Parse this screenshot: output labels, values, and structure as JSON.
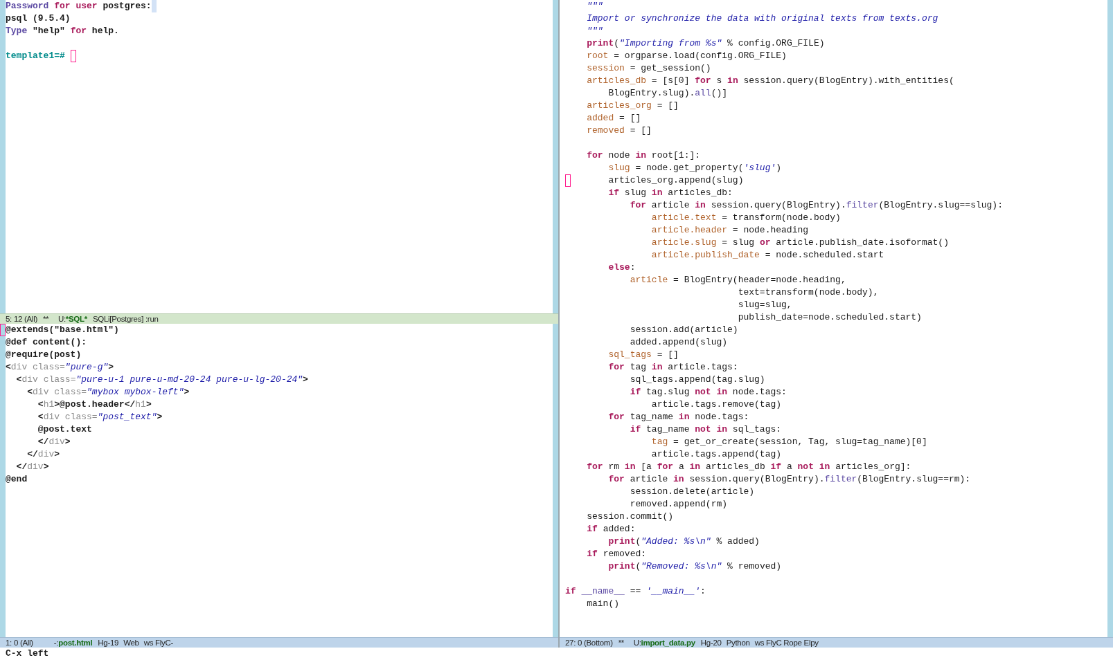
{
  "columns": [
    {
      "windows": [
        {
          "kind": "terminal",
          "selected": true,
          "lines": [
            {
              "kind": "code",
              "tokens": [
                {
                  "kind": "builtin",
                  "text": "Password"
                },
                {
                  "kind": "keyword",
                  "text": " for user"
                },
                {
                  "kind": "plain",
                  "text": " postgres:"
                },
                {
                  "kind": "highlight"
                }
              ]
            },
            {
              "kind": "code",
              "tokens": [
                {
                  "kind": "plain",
                  "text": "psql (9.5.4)"
                }
              ]
            },
            {
              "kind": "code",
              "tokens": [
                {
                  "kind": "builtin",
                  "text": "Type"
                },
                {
                  "kind": "plain",
                  "text": " \"help\" "
                },
                {
                  "kind": "keyword",
                  "text": "for"
                },
                {
                  "kind": "plain",
                  "text": " help."
                }
              ]
            },
            {
              "kind": "blank"
            },
            {
              "kind": "code",
              "tokens": [
                {
                  "kind": "prompt",
                  "text": "template1=#"
                },
                {
                  "kind": "cursor"
                }
              ]
            }
          ],
          "mode_line": {
            "position": "5: 12 (All)",
            "flags": "**",
            "prefix": "U:",
            "buffer": "*SQL*",
            "modes": [
              "SQLi[Postgres] :run"
            ]
          }
        },
        {
          "kind": "template",
          "selected": false,
          "lines": [
            {
              "kind": "code",
              "tokens": [
                {
                  "kind": "cursor"
                },
                {
                  "kind": "plain",
                  "text": "@extends(\"base.html\")"
                }
              ]
            },
            {
              "kind": "code",
              "tokens": [
                {
                  "kind": "plain",
                  "text": "@def content():"
                }
              ]
            },
            {
              "kind": "code",
              "tokens": [
                {
                  "kind": "plain",
                  "text": "@require(post)"
                }
              ]
            },
            {
              "kind": "code",
              "tokens": [
                {
                  "kind": "plain",
                  "text": "<"
                },
                {
                  "kind": "tag",
                  "text": "div class="
                },
                {
                  "kind": "string",
                  "text": "\"pure-g\""
                },
                {
                  "kind": "plain",
                  "text": ">"
                }
              ]
            },
            {
              "kind": "code",
              "tokens": [
                {
                  "kind": "plain",
                  "text": "  <"
                },
                {
                  "kind": "tag",
                  "text": "div class="
                },
                {
                  "kind": "string",
                  "text": "\"pure-u-1 pure-u-md-20-24 pure-u-lg-20-24\""
                },
                {
                  "kind": "plain",
                  "text": ">"
                }
              ]
            },
            {
              "kind": "code",
              "tokens": [
                {
                  "kind": "plain",
                  "text": "    <"
                },
                {
                  "kind": "tag",
                  "text": "div class="
                },
                {
                  "kind": "string",
                  "text": "\"mybox mybox-left\""
                },
                {
                  "kind": "plain",
                  "text": ">"
                }
              ]
            },
            {
              "kind": "code",
              "tokens": [
                {
                  "kind": "plain",
                  "text": "      <"
                },
                {
                  "kind": "tag",
                  "text": "h1"
                },
                {
                  "kind": "plain",
                  "text": ">@post.header</"
                },
                {
                  "kind": "tag",
                  "text": "h1"
                },
                {
                  "kind": "plain",
                  "text": ">"
                }
              ]
            },
            {
              "kind": "code",
              "tokens": [
                {
                  "kind": "plain",
                  "text": "      <"
                },
                {
                  "kind": "tag",
                  "text": "div class="
                },
                {
                  "kind": "string",
                  "text": "\"post_text\""
                },
                {
                  "kind": "plain",
                  "text": ">"
                }
              ]
            },
            {
              "kind": "code",
              "tokens": [
                {
                  "kind": "plain",
                  "text": "      @post.text"
                }
              ]
            },
            {
              "kind": "code",
              "tokens": [
                {
                  "kind": "plain",
                  "text": "      </"
                },
                {
                  "kind": "tag",
                  "text": "div"
                },
                {
                  "kind": "plain",
                  "text": ">"
                }
              ]
            },
            {
              "kind": "code",
              "tokens": [
                {
                  "kind": "plain",
                  "text": "    </"
                },
                {
                  "kind": "tag",
                  "text": "div"
                },
                {
                  "kind": "plain",
                  "text": ">"
                }
              ]
            },
            {
              "kind": "code",
              "tokens": [
                {
                  "kind": "plain",
                  "text": "  </"
                },
                {
                  "kind": "tag",
                  "text": "div"
                },
                {
                  "kind": "plain",
                  "text": ">"
                }
              ]
            },
            {
              "kind": "code",
              "tokens": [
                {
                  "kind": "plain",
                  "text": "@end"
                }
              ]
            }
          ],
          "mode_line": {
            "position": "1: 0 (All)",
            "prefix": "-:",
            "buffer": "post.html",
            "modes": [
              "Hg-19",
              "Web",
              "ws FlyC-"
            ]
          }
        }
      ]
    },
    {
      "windows": [
        {
          "kind": "python",
          "selected": false,
          "lines": [
            {
              "kind": "code",
              "tokens": [
                {
                  "kind": "string",
                  "text": "    \"\"\""
                }
              ]
            },
            {
              "kind": "code",
              "tokens": [
                {
                  "kind": "string",
                  "text": "    Import or synchronize the data with original texts from texts.org"
                }
              ]
            },
            {
              "kind": "code",
              "tokens": [
                {
                  "kind": "string",
                  "text": "    \"\"\""
                }
              ]
            },
            {
              "kind": "code",
              "tokens": [
                {
                  "kind": "keyword",
                  "text": "    print"
                },
                {
                  "kind": "plain",
                  "text": "("
                },
                {
                  "kind": "string",
                  "text": "\"Importing from %s\""
                },
                {
                  "kind": "plain",
                  "text": " % config.ORG_FILE)"
                }
              ]
            },
            {
              "kind": "code",
              "tokens": [
                {
                  "kind": "variable",
                  "text": "    root"
                },
                {
                  "kind": "plain",
                  "text": " = orgparse.load(config.ORG_FILE)"
                }
              ]
            },
            {
              "kind": "code",
              "tokens": [
                {
                  "kind": "variable",
                  "text": "    session"
                },
                {
                  "kind": "plain",
                  "text": " = get_session()"
                }
              ]
            },
            {
              "kind": "code",
              "tokens": [
                {
                  "kind": "variable",
                  "text": "    articles_db"
                },
                {
                  "kind": "plain",
                  "text": " = [s[0] "
                },
                {
                  "kind": "keyword",
                  "text": "for"
                },
                {
                  "kind": "plain",
                  "text": " s "
                },
                {
                  "kind": "keyword",
                  "text": "in"
                },
                {
                  "kind": "plain",
                  "text": " session.query(BlogEntry).with_entities("
                }
              ]
            },
            {
              "kind": "code",
              "tokens": [
                {
                  "kind": "plain",
                  "text": "        BlogEntry.slug)."
                },
                {
                  "kind": "builtin",
                  "text": "all"
                },
                {
                  "kind": "plain",
                  "text": "()]"
                }
              ]
            },
            {
              "kind": "code",
              "tokens": [
                {
                  "kind": "variable",
                  "text": "    articles_org"
                },
                {
                  "kind": "plain",
                  "text": " = []"
                }
              ]
            },
            {
              "kind": "code",
              "tokens": [
                {
                  "kind": "variable",
                  "text": "    added"
                },
                {
                  "kind": "plain",
                  "text": " = []"
                }
              ]
            },
            {
              "kind": "code",
              "tokens": [
                {
                  "kind": "variable",
                  "text": "    removed"
                },
                {
                  "kind": "plain",
                  "text": " = []"
                }
              ]
            },
            {
              "kind": "blank"
            },
            {
              "kind": "code",
              "tokens": [
                {
                  "kind": "keyword",
                  "text": "    for"
                },
                {
                  "kind": "plain",
                  "text": " node "
                },
                {
                  "kind": "keyword",
                  "text": "in"
                },
                {
                  "kind": "plain",
                  "text": " root[1:]:"
                }
              ]
            },
            {
              "kind": "code",
              "tokens": [
                {
                  "kind": "variable",
                  "text": "        slug"
                },
                {
                  "kind": "plain",
                  "text": " = node.get_property("
                },
                {
                  "kind": "string",
                  "text": "'slug'"
                },
                {
                  "kind": "plain",
                  "text": ")"
                }
              ]
            },
            {
              "kind": "code",
              "tokens": [
                {
                  "kind": "cursor"
                },
                {
                  "kind": "plain",
                  "text": "        articles_org.append(slug)"
                }
              ]
            },
            {
              "kind": "code",
              "tokens": [
                {
                  "kind": "keyword",
                  "text": "        if"
                },
                {
                  "kind": "plain",
                  "text": " slug "
                },
                {
                  "kind": "keyword",
                  "text": "in"
                },
                {
                  "kind": "plain",
                  "text": " articles_db:"
                }
              ]
            },
            {
              "kind": "code",
              "tokens": [
                {
                  "kind": "keyword",
                  "text": "            for"
                },
                {
                  "kind": "plain",
                  "text": " article "
                },
                {
                  "kind": "keyword",
                  "text": "in"
                },
                {
                  "kind": "plain",
                  "text": " session.query(BlogEntry)."
                },
                {
                  "kind": "builtin",
                  "text": "filter"
                },
                {
                  "kind": "plain",
                  "text": "(BlogEntry.slug==slug):"
                }
              ]
            },
            {
              "kind": "code",
              "tokens": [
                {
                  "kind": "variable",
                  "text": "                article.text"
                },
                {
                  "kind": "plain",
                  "text": " = transform(node.body)"
                }
              ]
            },
            {
              "kind": "code",
              "tokens": [
                {
                  "kind": "variable",
                  "text": "                article.header"
                },
                {
                  "kind": "plain",
                  "text": " = node.heading"
                }
              ]
            },
            {
              "kind": "code",
              "tokens": [
                {
                  "kind": "variable",
                  "text": "                article.slug"
                },
                {
                  "kind": "plain",
                  "text": " = slug "
                },
                {
                  "kind": "keyword",
                  "text": "or"
                },
                {
                  "kind": "plain",
                  "text": " article.publish_date.isoformat()"
                }
              ]
            },
            {
              "kind": "code",
              "tokens": [
                {
                  "kind": "variable",
                  "text": "                article.publish_date"
                },
                {
                  "kind": "plain",
                  "text": " = node.scheduled.start"
                }
              ]
            },
            {
              "kind": "code",
              "tokens": [
                {
                  "kind": "keyword",
                  "text": "        else"
                },
                {
                  "kind": "plain",
                  "text": ":"
                }
              ]
            },
            {
              "kind": "code",
              "tokens": [
                {
                  "kind": "variable",
                  "text": "            article"
                },
                {
                  "kind": "plain",
                  "text": " = BlogEntry(header=node.heading,"
                }
              ]
            },
            {
              "kind": "code",
              "tokens": [
                {
                  "kind": "plain",
                  "text": "                                text=transform(node.body),"
                }
              ]
            },
            {
              "kind": "code",
              "tokens": [
                {
                  "kind": "plain",
                  "text": "                                slug=slug,"
                }
              ]
            },
            {
              "kind": "code",
              "tokens": [
                {
                  "kind": "plain",
                  "text": "                                publish_date=node.scheduled.start)"
                }
              ]
            },
            {
              "kind": "code",
              "tokens": [
                {
                  "kind": "plain",
                  "text": "            session.add(article)"
                }
              ]
            },
            {
              "kind": "code",
              "tokens": [
                {
                  "kind": "plain",
                  "text": "            added.append(slug)"
                }
              ]
            },
            {
              "kind": "code",
              "tokens": [
                {
                  "kind": "variable",
                  "text": "        sql_tags"
                },
                {
                  "kind": "plain",
                  "text": " = []"
                }
              ]
            },
            {
              "kind": "code",
              "tokens": [
                {
                  "kind": "keyword",
                  "text": "        for"
                },
                {
                  "kind": "plain",
                  "text": " tag "
                },
                {
                  "kind": "keyword",
                  "text": "in"
                },
                {
                  "kind": "plain",
                  "text": " article.tags:"
                }
              ]
            },
            {
              "kind": "code",
              "tokens": [
                {
                  "kind": "plain",
                  "text": "            sql_tags.append(tag.slug)"
                }
              ]
            },
            {
              "kind": "code",
              "tokens": [
                {
                  "kind": "keyword",
                  "text": "            if"
                },
                {
                  "kind": "plain",
                  "text": " tag.slug "
                },
                {
                  "kind": "keyword",
                  "text": "not in"
                },
                {
                  "kind": "plain",
                  "text": " node.tags:"
                }
              ]
            },
            {
              "kind": "code",
              "tokens": [
                {
                  "kind": "plain",
                  "text": "                article.tags.remove(tag)"
                }
              ]
            },
            {
              "kind": "code",
              "tokens": [
                {
                  "kind": "keyword",
                  "text": "        for"
                },
                {
                  "kind": "plain",
                  "text": " tag_name "
                },
                {
                  "kind": "keyword",
                  "text": "in"
                },
                {
                  "kind": "plain",
                  "text": " node.tags:"
                }
              ]
            },
            {
              "kind": "code",
              "tokens": [
                {
                  "kind": "keyword",
                  "text": "            if"
                },
                {
                  "kind": "plain",
                  "text": " tag_name "
                },
                {
                  "kind": "keyword",
                  "text": "not in"
                },
                {
                  "kind": "plain",
                  "text": " sql_tags:"
                }
              ]
            },
            {
              "kind": "code",
              "tokens": [
                {
                  "kind": "variable",
                  "text": "                tag"
                },
                {
                  "kind": "plain",
                  "text": " = get_or_create(session, Tag, slug=tag_name)[0]"
                }
              ]
            },
            {
              "kind": "code",
              "tokens": [
                {
                  "kind": "plain",
                  "text": "                article.tags.append(tag)"
                }
              ]
            },
            {
              "kind": "code",
              "tokens": [
                {
                  "kind": "keyword",
                  "text": "    for"
                },
                {
                  "kind": "plain",
                  "text": " rm "
                },
                {
                  "kind": "keyword",
                  "text": "in"
                },
                {
                  "kind": "plain",
                  "text": " [a "
                },
                {
                  "kind": "keyword",
                  "text": "for"
                },
                {
                  "kind": "plain",
                  "text": " a "
                },
                {
                  "kind": "keyword",
                  "text": "in"
                },
                {
                  "kind": "plain",
                  "text": " articles_db "
                },
                {
                  "kind": "keyword",
                  "text": "if"
                },
                {
                  "kind": "plain",
                  "text": " a "
                },
                {
                  "kind": "keyword",
                  "text": "not in"
                },
                {
                  "kind": "plain",
                  "text": " articles_org]:"
                }
              ]
            },
            {
              "kind": "code",
              "tokens": [
                {
                  "kind": "keyword",
                  "text": "        for"
                },
                {
                  "kind": "plain",
                  "text": " article "
                },
                {
                  "kind": "keyword",
                  "text": "in"
                },
                {
                  "kind": "plain",
                  "text": " session.query(BlogEntry)."
                },
                {
                  "kind": "builtin",
                  "text": "filter"
                },
                {
                  "kind": "plain",
                  "text": "(BlogEntry.slug==rm):"
                }
              ]
            },
            {
              "kind": "code",
              "tokens": [
                {
                  "kind": "plain",
                  "text": "            session.delete(article)"
                }
              ]
            },
            {
              "kind": "code",
              "tokens": [
                {
                  "kind": "plain",
                  "text": "            removed.append(rm)"
                }
              ]
            },
            {
              "kind": "code",
              "tokens": [
                {
                  "kind": "plain",
                  "text": "    session.commit()"
                }
              ]
            },
            {
              "kind": "code",
              "tokens": [
                {
                  "kind": "keyword",
                  "text": "    if"
                },
                {
                  "kind": "plain",
                  "text": " added:"
                }
              ]
            },
            {
              "kind": "code",
              "tokens": [
                {
                  "kind": "keyword",
                  "text": "        print"
                },
                {
                  "kind": "plain",
                  "text": "("
                },
                {
                  "kind": "string",
                  "text": "\"Added: %s\\n\""
                },
                {
                  "kind": "plain",
                  "text": " % added)"
                }
              ]
            },
            {
              "kind": "code",
              "tokens": [
                {
                  "kind": "keyword",
                  "text": "    if"
                },
                {
                  "kind": "plain",
                  "text": " removed:"
                }
              ]
            },
            {
              "kind": "code",
              "tokens": [
                {
                  "kind": "keyword",
                  "text": "        print"
                },
                {
                  "kind": "plain",
                  "text": "("
                },
                {
                  "kind": "string",
                  "text": "\"Removed: %s\\n\""
                },
                {
                  "kind": "plain",
                  "text": " % removed)"
                }
              ]
            },
            {
              "kind": "blank"
            },
            {
              "kind": "code",
              "tokens": [
                {
                  "kind": "keyword",
                  "text": "if "
                },
                {
                  "kind": "builtin",
                  "text": "__name__"
                },
                {
                  "kind": "plain",
                  "text": " == "
                },
                {
                  "kind": "string",
                  "text": "'__main__'"
                },
                {
                  "kind": "plain",
                  "text": ":"
                }
              ]
            },
            {
              "kind": "code",
              "tokens": [
                {
                  "kind": "plain",
                  "text": "    main()"
                }
              ]
            }
          ],
          "mode_line": {
            "position": "27: 0 (Bottom)",
            "flags": "**",
            "prefix": "U:",
            "buffer": "import_data.py",
            "modes": [
              "Hg-20",
              "Python",
              "ws FlyC Rope Elpy"
            ]
          }
        }
      ]
    }
  ],
  "echo_area": "C-x left"
}
